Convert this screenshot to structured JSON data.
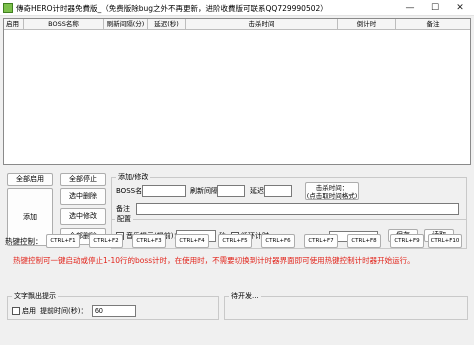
{
  "window": {
    "title": "傳奇HERO计时器免費版_（免费版除bug之外不再更新，进阶收費版可联系QQ729990502）",
    "minimize_glyph": "—",
    "maximize_glyph": "☐",
    "close_glyph": "✕"
  },
  "grid": {
    "columns": [
      "启用",
      "BOSS名称",
      "刷新间隔(分)",
      "延迟(秒)",
      "击杀时间",
      "倒计时",
      "备注"
    ]
  },
  "left_buttons": {
    "all_enable": "全部启用",
    "all_stop": "全部停止",
    "add": "添加",
    "delete_selected": "选中删除",
    "modify_selected": "选中修改",
    "delete_all": "全部删除"
  },
  "add_modify": {
    "group_title": "添加/修改",
    "boss_name_label": "BOSS名称",
    "boss_name_value": "",
    "refresh_label": "刷新间隔",
    "refresh_value": "",
    "delay_label": "延迟",
    "delay_value": "",
    "hit_time_button": "击杀时间：\n(点击取时间格式)",
    "remark_label": "备注",
    "remark_value": ""
  },
  "config": {
    "group_title": "配置",
    "music_prompt_label": "音乐提示(提前)：",
    "music_prompt_value": "",
    "seconds_label": "秒",
    "loop_timer_label": "循环计时",
    "sound_select_value": "",
    "save_button": "保存",
    "read_button": "读取"
  },
  "hotkeys": {
    "label": "热键控制：",
    "keys": [
      "CTRL+F1",
      "CTRL+F2",
      "CTRL+F3",
      "CTRL+F4",
      "CTRL+F5",
      "CTRL+F6",
      "CTRL+F7",
      "CTRL+F8",
      "CTRL+F9",
      "CTRL+F10"
    ]
  },
  "warning": {
    "text": "热键控制可一键启动或停止1-10行的boss计时，在使用时，不需要切换到计时器界面即可使用热键控制计时器开始运行。",
    "color": "#e2231a"
  },
  "text_message": {
    "group_title": "文字飘出提示",
    "enable_label": "启用",
    "advance_label": "提前时间(秒)：",
    "advance_value": "60"
  },
  "developing": {
    "group_title": "待开发..."
  }
}
